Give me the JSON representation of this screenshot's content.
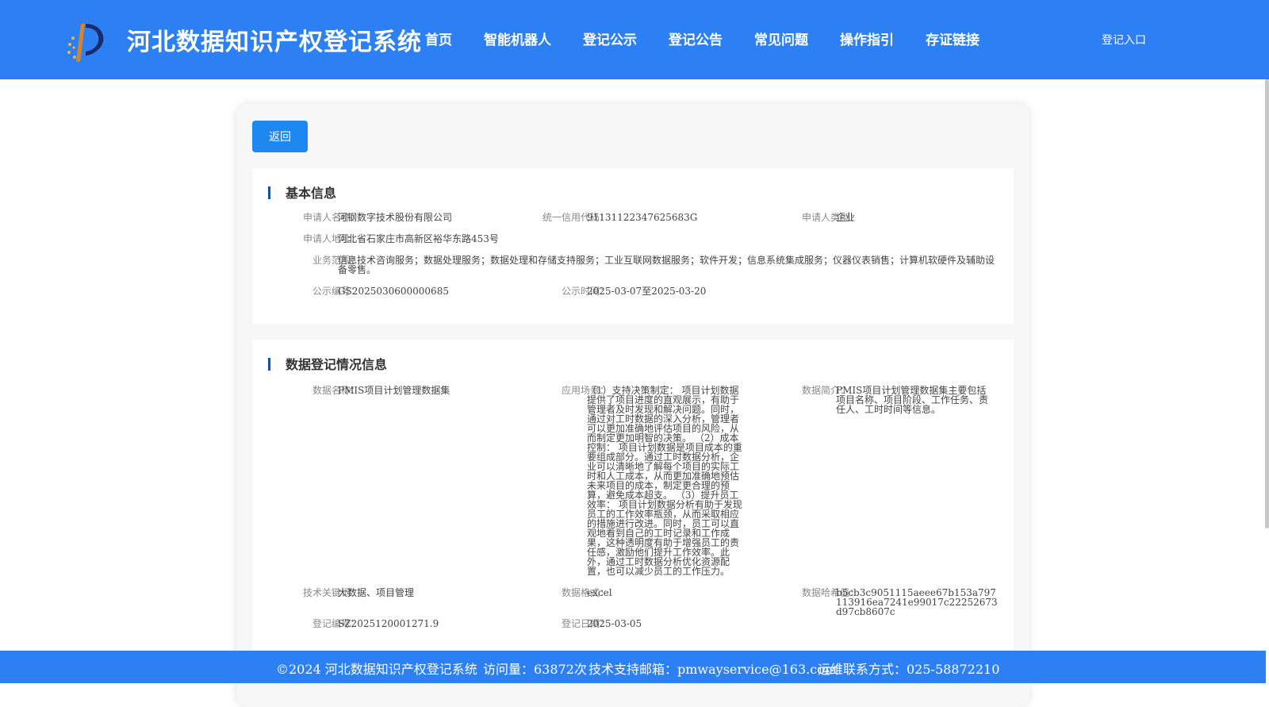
{
  "header": {
    "site_title": "河北数据知识产权登记系统",
    "nav": [
      "首页",
      "智能机器人",
      "登记公示",
      "登记公告",
      "常见问题",
      "操作指引",
      "存证链接"
    ],
    "login": "登记入口"
  },
  "back_button": "返回",
  "basic_info": {
    "title": "基本信息",
    "applicant_name_label": "申请人名称：",
    "applicant_name": "河钢数字技术股份有限公司",
    "credit_code_label": "统一信用代码：",
    "credit_code": "91131122347625683G",
    "applicant_type_label": "申请人类型：",
    "applicant_type": "企业",
    "address_label": "申请人地址：",
    "address": "河北省石家庄市高新区裕华东路453号",
    "scope_label": "业务范围：",
    "scope": "信息技术咨询服务；数据处理服务；数据处理和存储支持服务；工业互联网数据服务；软件开发；信息系统集成服务；仪器仪表销售；计算机软硬件及辅助设备零售。",
    "pub_no_label": "公示编号：",
    "pub_no": "GS2025030600000685",
    "pub_time_label": "公示时间：",
    "pub_time": "2025-03-07至2025-03-20"
  },
  "data_info": {
    "title": "数据登记情况信息",
    "name_label": "数据名称：",
    "name": "PMIS项目计划管理数据集",
    "scenario_label": "应用场景：",
    "scenario": "（1）支持决策制定： 项目计划数据提供了项目进度的直观展示，有助于管理者及时发现和解决问题。同时，通过对工时数据的深入分析，管理者可以更加准确地评估项目的风险，从而制定更加明智的决策。 （2）成本控制： 项目计划数据是项目成本的重要组成部分。通过工时数据分析，企业可以清晰地了解每个项目的实际工时和人工成本，从而更加准确地预估未来项目的成本，制定更合理的预算，避免成本超支。 （3）提升员工效率： 项目计划数据分析有助于发现员工的工作效率瓶颈，从而采取相应的措施进行改进。同时，员工可以直观地看到自己的工时记录和工作成果，这种透明度有助于增强员工的责任感，激励他们提升工作效率。此外，通过工时数据分析优化资源配置，也可以减少员工的工作压力。",
    "intro_label": "数据简介：",
    "intro": "PMIS项目计划管理数据集主要包括项目名称、项目阶段、工作任务、责任人、工时时间等信息。",
    "keywords_label": "技术关键词：",
    "keywords": "大数据、项目管理",
    "format_label": "数据格式：",
    "format": "excel",
    "hash_label": "数据哈希值：",
    "hash": "b5cb3c9051115aeee67b153a797113916ea7241e99017c22252673d97cb8607c",
    "reg_no_label": "登记编号：",
    "reg_no": "SZ2025120001271.9",
    "reg_date_label": "登记日期：",
    "reg_date": "2025-03-05"
  },
  "footer": {
    "copyright": "©2024 河北数据知识产权登记系统",
    "visits": "访问量：63872次",
    "email": "技术支持邮箱：pmwayservice@163.com",
    "phone": "运维联系方式：025-58872210"
  },
  "colors": {
    "brand_blue": "#2d80f4",
    "button_blue": "#1e88f0",
    "title_bar": "#1a4fa0"
  }
}
